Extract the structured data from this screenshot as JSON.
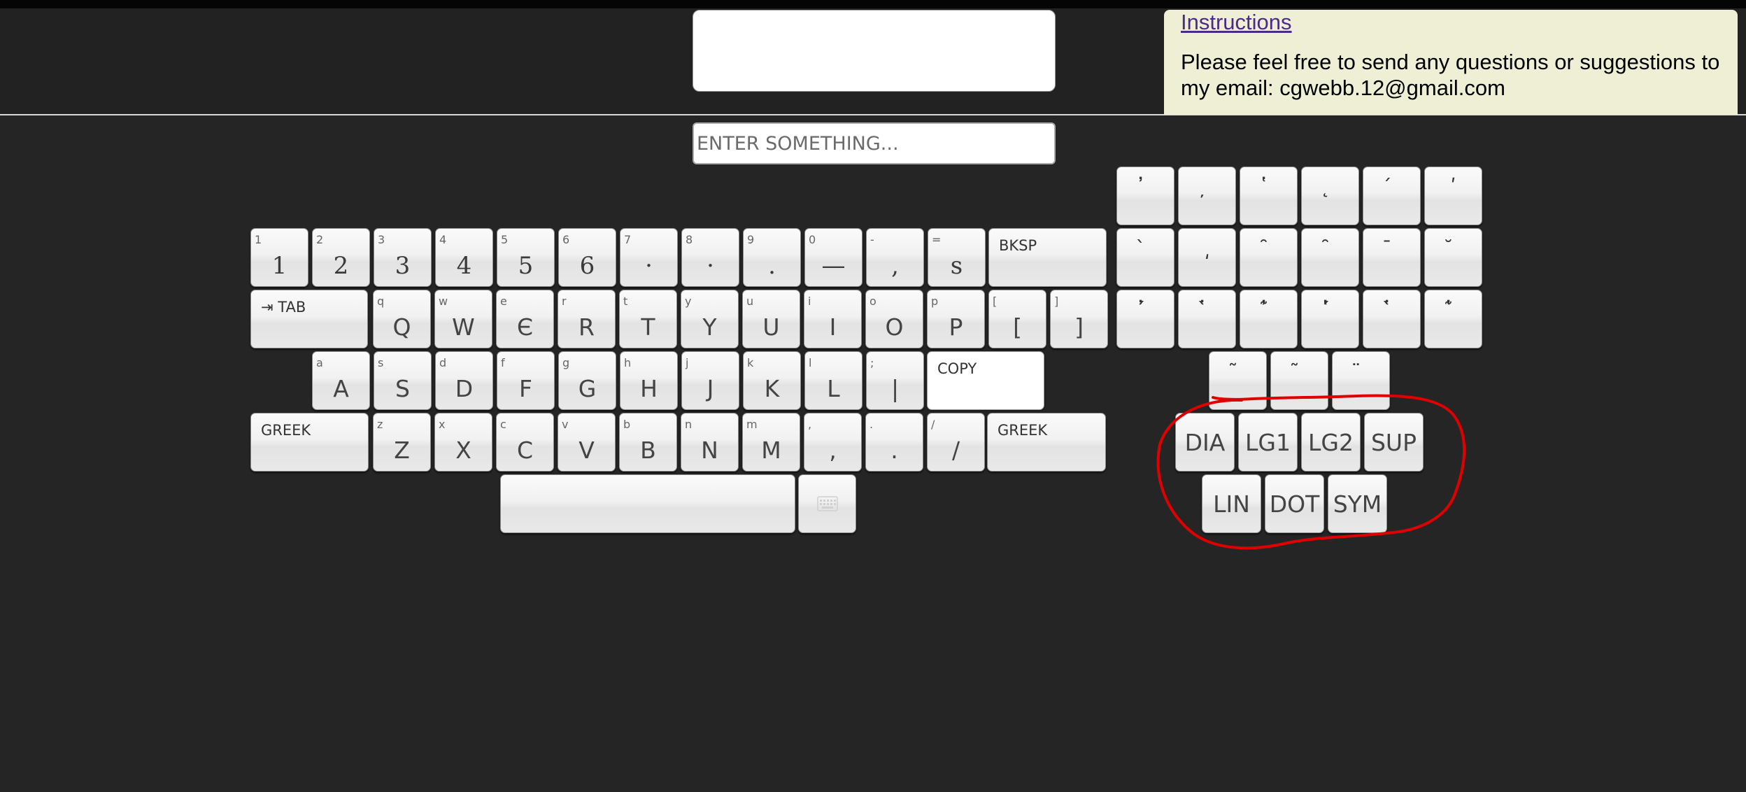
{
  "instructions": {
    "link_label": "Instructions",
    "message": "Please feel free to send any questions or suggestions to my email: cgwebb.12@gmail.com"
  },
  "input": {
    "placeholder": "ENTER SOMETHING...",
    "value": ""
  },
  "keyboard": {
    "row1": [
      {
        "sub": "1",
        "main": "1"
      },
      {
        "sub": "2",
        "main": "2"
      },
      {
        "sub": "3",
        "main": "3"
      },
      {
        "sub": "4",
        "main": "4"
      },
      {
        "sub": "5",
        "main": "5"
      },
      {
        "sub": "6",
        "main": "6"
      },
      {
        "sub": "7",
        "main": "·"
      },
      {
        "sub": "8",
        "main": "·"
      },
      {
        "sub": "9",
        "main": "."
      },
      {
        "sub": "0",
        "main": "—"
      },
      {
        "sub": "-",
        "main": ","
      },
      {
        "sub": "=",
        "main": "s"
      }
    ],
    "row2": [
      {
        "sub": "q",
        "main": "Q"
      },
      {
        "sub": "w",
        "main": "W"
      },
      {
        "sub": "e",
        "main": "Є"
      },
      {
        "sub": "r",
        "main": "R"
      },
      {
        "sub": "t",
        "main": "T"
      },
      {
        "sub": "y",
        "main": "Y"
      },
      {
        "sub": "u",
        "main": "U"
      },
      {
        "sub": "i",
        "main": "I"
      },
      {
        "sub": "o",
        "main": "O"
      },
      {
        "sub": "p",
        "main": "P"
      },
      {
        "sub": "[",
        "main": "["
      },
      {
        "sub": "]",
        "main": "]"
      }
    ],
    "row3": [
      {
        "sub": "a",
        "main": "A"
      },
      {
        "sub": "s",
        "main": "S"
      },
      {
        "sub": "d",
        "main": "D"
      },
      {
        "sub": "f",
        "main": "F"
      },
      {
        "sub": "g",
        "main": "G"
      },
      {
        "sub": "h",
        "main": "H"
      },
      {
        "sub": "j",
        "main": "J"
      },
      {
        "sub": "k",
        "main": "K"
      },
      {
        "sub": "l",
        "main": "L"
      },
      {
        "sub": ";",
        "main": "|"
      }
    ],
    "row4": [
      {
        "sub": "z",
        "main": "Z"
      },
      {
        "sub": "x",
        "main": "X"
      },
      {
        "sub": "c",
        "main": "C"
      },
      {
        "sub": "v",
        "main": "V"
      },
      {
        "sub": "b",
        "main": "B"
      },
      {
        "sub": "n",
        "main": "N"
      },
      {
        "sub": "m",
        "main": "M"
      },
      {
        "sub": ",",
        "main": ","
      },
      {
        "sub": ".",
        "main": "."
      },
      {
        "sub": "/",
        "main": "/"
      }
    ],
    "bksp_label": "BKSP",
    "tab_label": "⇥ TAB",
    "copy_label": "COPY",
    "greek_left_label": "GREEK",
    "greek_right_label": "GREEK",
    "keyboard_icon": "keyboard-icon"
  },
  "accents": {
    "row1": [
      "̓",
      "̦",
      "̔",
      "̨",
      "́",
      "ʹ"
    ],
    "row2": [
      "̀",
      "͵",
      "̑",
      "̑",
      "̄",
      "̆"
    ],
    "row3": [
      "̓́",
      "̔̀",
      "̓͂",
      "̔́",
      "̔̀",
      "̔͂"
    ],
    "row4": [
      "̃",
      "̃",
      "̈"
    ]
  },
  "modes": {
    "row1": [
      "DIA",
      "LG1",
      "LG2",
      "SUP"
    ],
    "row2": [
      "LIN",
      "DOT",
      "SYM"
    ]
  },
  "annotation_color": "#e00000"
}
